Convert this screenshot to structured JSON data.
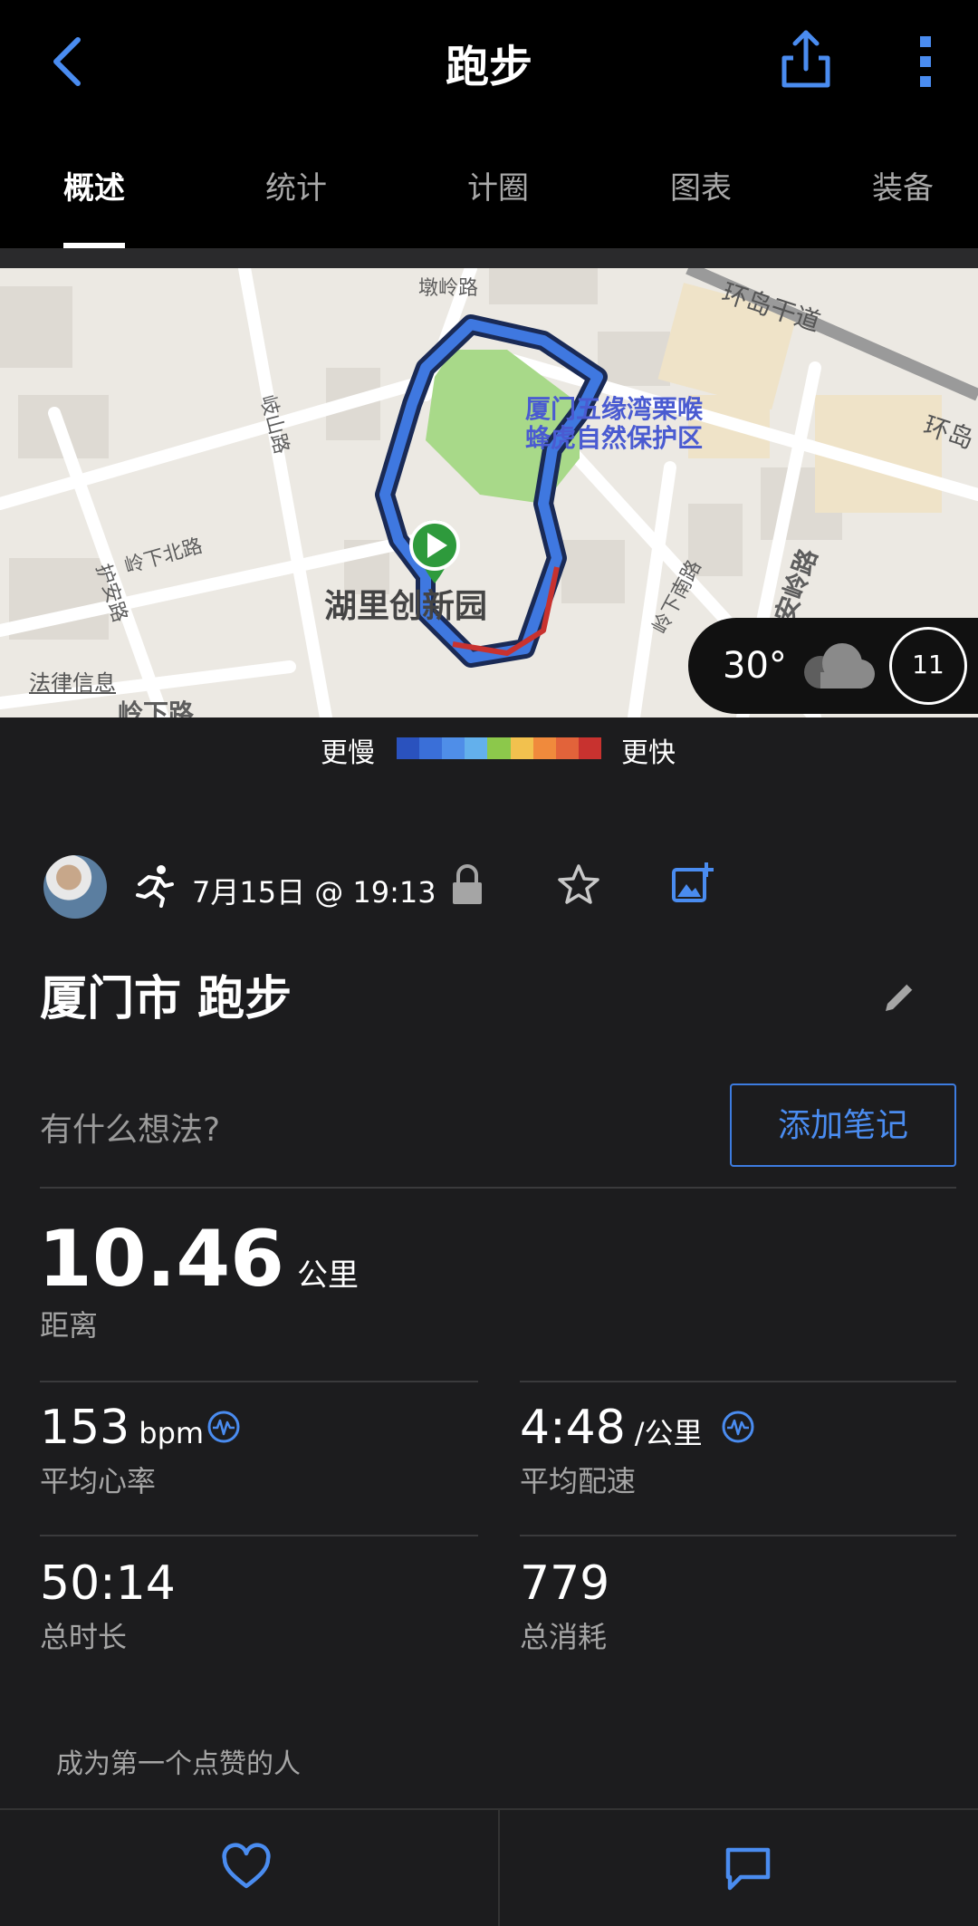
{
  "header": {
    "title": "跑步"
  },
  "tabs": [
    {
      "label": "概述",
      "active": true
    },
    {
      "label": "统计"
    },
    {
      "label": "计圈"
    },
    {
      "label": "图表"
    },
    {
      "label": "装备"
    }
  ],
  "map": {
    "streets": [
      "墩岭路",
      "环岛干道",
      "环岛",
      "岐山路",
      "岭下北路",
      "护安路",
      "岭下南路",
      "安岭路",
      "岭下路"
    ],
    "poi": "厦门五缘湾栗喉\n蜂虎自然保护区",
    "place": "湖里创新园",
    "legal": "法律信息",
    "weather": {
      "temperature": "30°",
      "wind_speed": "11",
      "icon": "cloud-icon"
    }
  },
  "pace_legend": {
    "slow_label": "更慢",
    "fast_label": "更快",
    "colors": [
      "#2a52be",
      "#3a6fd8",
      "#4f8ee8",
      "#63b0ec",
      "#8cc84b",
      "#f2c14e",
      "#f08a3c",
      "#e2633a",
      "#c8322f"
    ]
  },
  "activity": {
    "date_time": "7月15日 @ 19:13",
    "title": "厦门市 跑步",
    "thoughts_placeholder": "有什么想法?",
    "add_note_label": "添加笔记"
  },
  "stats": {
    "distance": {
      "value": "10.46",
      "unit": "公里",
      "label": "距离"
    },
    "avg_hr": {
      "value": "153",
      "unit": "bpm",
      "label": "平均心率"
    },
    "avg_pace": {
      "value": "4:48",
      "unit": "/公里",
      "label": "平均配速"
    },
    "duration": {
      "value": "50:14",
      "label": "总时长"
    },
    "calories": {
      "value": "779",
      "label": "总消耗"
    }
  },
  "social": {
    "likes_text": "成为第一个点赞的人"
  },
  "colors": {
    "accent": "#4a8cf0",
    "background": "#1c1c1e",
    "header": "#000000"
  }
}
